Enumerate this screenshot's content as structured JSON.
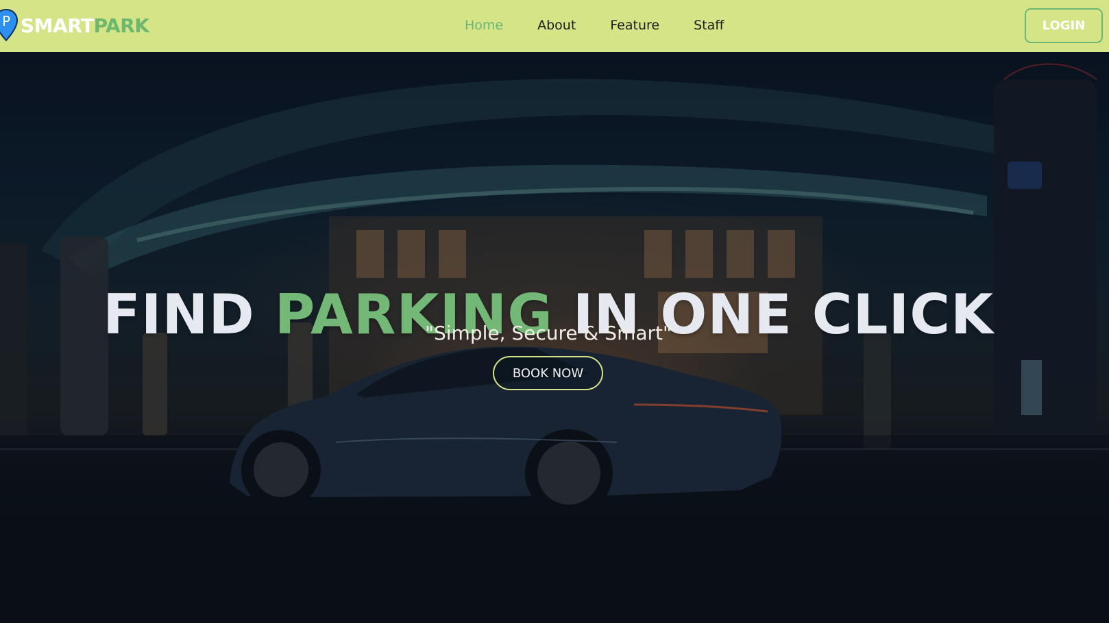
{
  "brand": {
    "name_part1": "SMART",
    "name_part2": "PARK",
    "pin_glyph": "P",
    "pin_color": "#2d8ff0",
    "accent_color": "#6db86e"
  },
  "nav": {
    "background": "#d6e488",
    "items": [
      {
        "label": "Home",
        "active": true
      },
      {
        "label": "About",
        "active": false
      },
      {
        "label": "Feature",
        "active": false
      },
      {
        "label": "Staff",
        "active": false
      }
    ],
    "login_label": "LOGIN"
  },
  "hero": {
    "title_part1": "FIND",
    "title_accent": "PARKING",
    "title_part2": "IN ONE CLICK",
    "subtitle": "\"Simple, Secure & Smart\"",
    "cta_label": "BOOK NOW",
    "background_image": "night-ev-charging-station-car-icon"
  }
}
